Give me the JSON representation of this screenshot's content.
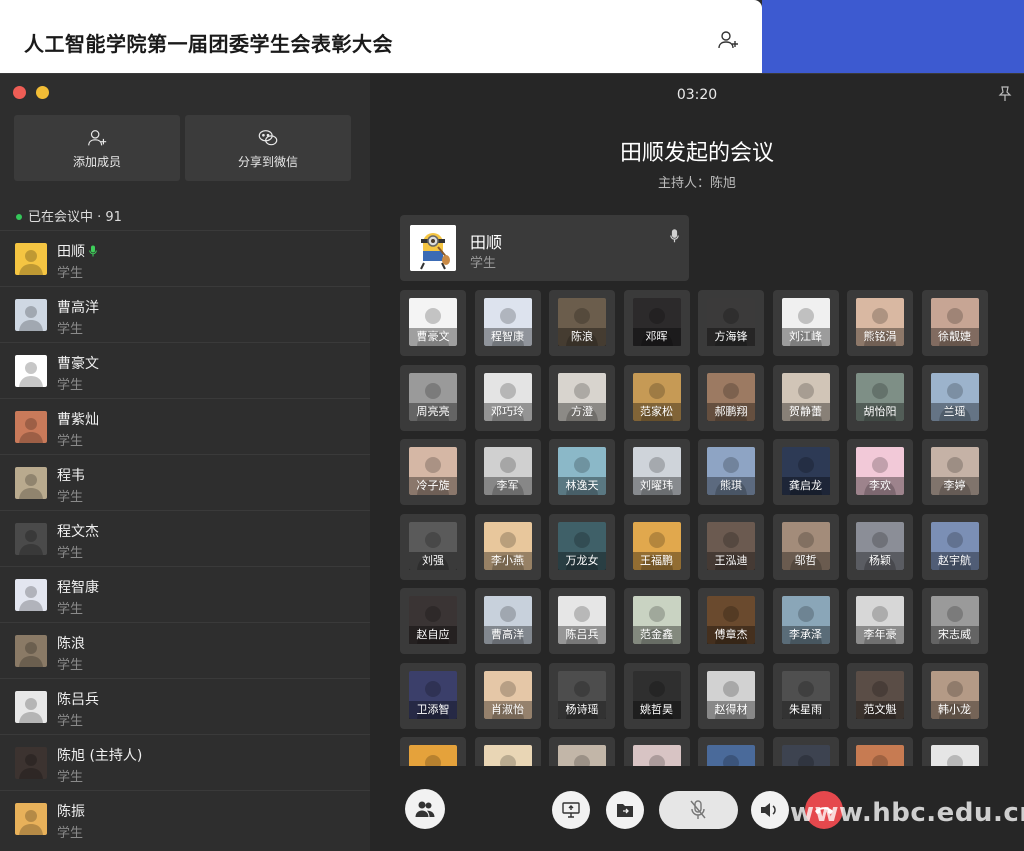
{
  "background": {
    "page_title": "人工智能学院第一届团委学生会表彰大会"
  },
  "sidebar": {
    "add_member_label": "添加成员",
    "share_wechat_label": "分享到微信",
    "in_meeting_label": "已在会议中 · 91",
    "members": [
      {
        "name": "田顺",
        "role": "学生",
        "speaking": true,
        "avatar": "minion",
        "color": "#f5c542"
      },
      {
        "name": "曹高洋",
        "role": "学生",
        "avatar": "anime",
        "color": "#cfd8e3"
      },
      {
        "name": "曹豪文",
        "role": "学生",
        "avatar": "sketch",
        "color": "#ffffff"
      },
      {
        "name": "曹紫灿",
        "role": "学生",
        "avatar": "portrait",
        "color": "#c97a5a"
      },
      {
        "name": "程韦",
        "role": "学生",
        "avatar": "photo",
        "color": "#b9aa8e"
      },
      {
        "name": "程文杰",
        "role": "学生",
        "avatar": "photo",
        "color": "#4a4a4a"
      },
      {
        "name": "程智康",
        "role": "学生",
        "avatar": "anime",
        "color": "#e3e6f0"
      },
      {
        "name": "陈浪",
        "role": "学生",
        "avatar": "photo",
        "color": "#8a7a66"
      },
      {
        "name": "陈吕兵",
        "role": "学生",
        "avatar": "sketch",
        "color": "#e8e8e8"
      },
      {
        "name": "陈旭 (主持人)",
        "role": "学生",
        "avatar": "portrait",
        "color": "#3c3330"
      },
      {
        "name": "陈振",
        "role": "学生",
        "avatar": "cartoon",
        "color": "#e8b15a"
      }
    ]
  },
  "main": {
    "timer": "03:20",
    "meeting_title": "田顺发起的会议",
    "host_label": "主持人：陈旭",
    "speaker": {
      "name": "田顺",
      "role": "学生"
    },
    "participants": [
      {
        "name": "曹豪文",
        "color": "#f4f4f4"
      },
      {
        "name": "程智康",
        "color": "#dde3ee"
      },
      {
        "name": "陈浪",
        "color": "#6b5d4c"
      },
      {
        "name": "邓晖",
        "color": "#2c2a2b"
      },
      {
        "name": "方海锋",
        "color": "#3b3a3a"
      },
      {
        "name": "刘江峰",
        "color": "#f0f0f0"
      },
      {
        "name": "熊铭涓",
        "color": "#d9b8a2"
      },
      {
        "name": "徐靓婕",
        "color": "#c7a594"
      },
      {
        "name": "周亮亮",
        "color": "#9a9a9a"
      },
      {
        "name": "邓巧玲",
        "color": "#e4e4e4"
      },
      {
        "name": "方澄",
        "color": "#d8d4ce"
      },
      {
        "name": "范家松",
        "color": "#c69a55"
      },
      {
        "name": "郝鹏翔",
        "color": "#9c7a62"
      },
      {
        "name": "贺静蕾",
        "color": "#d1c5b7"
      },
      {
        "name": "胡怡阳",
        "color": "#7e8f86"
      },
      {
        "name": "兰瑶",
        "color": "#9cb3cc"
      },
      {
        "name": "冷子旋",
        "color": "#d5b7a5"
      },
      {
        "name": "李军",
        "color": "#d0d0d0"
      },
      {
        "name": "林逸天",
        "color": "#8bb8c8"
      },
      {
        "name": "刘曜玮",
        "color": "#cfd4da"
      },
      {
        "name": "熊琪",
        "color": "#8ea4c4"
      },
      {
        "name": "龚启龙",
        "color": "#2d3a55"
      },
      {
        "name": "李欢",
        "color": "#f2c9d8"
      },
      {
        "name": "李婷",
        "color": "#c5b2a6"
      },
      {
        "name": "刘强",
        "color": "#5a5a5a"
      },
      {
        "name": "李小燕",
        "color": "#e8c79c"
      },
      {
        "name": "万龙女",
        "color": "#3f6068"
      },
      {
        "name": "王福鹏",
        "color": "#e1a84d"
      },
      {
        "name": "王泓迪",
        "color": "#6b5a50"
      },
      {
        "name": "邬哲",
        "color": "#a38c7a"
      },
      {
        "name": "杨颖",
        "color": "#8b8e97"
      },
      {
        "name": "赵宇航",
        "color": "#7b8fb5"
      },
      {
        "name": "赵自应",
        "color": "#3a3434"
      },
      {
        "name": "曹高洋",
        "color": "#c8d1dc"
      },
      {
        "name": "陈吕兵",
        "color": "#e6e6e6"
      },
      {
        "name": "范金鑫",
        "color": "#c9d3c2"
      },
      {
        "name": "傅章杰",
        "color": "#6a4a2e"
      },
      {
        "name": "李承泽",
        "color": "#8aa6b8"
      },
      {
        "name": "李年豪",
        "color": "#d7d7d7"
      },
      {
        "name": "宋志威",
        "color": "#9a9a9a"
      },
      {
        "name": "卫添智",
        "color": "#3b3f6a"
      },
      {
        "name": "肖淑怡",
        "color": "#e5c7a7"
      },
      {
        "name": "杨诗瑶",
        "color": "#4d4d4d"
      },
      {
        "name": "姚哲昊",
        "color": "#2f2f2f"
      },
      {
        "name": "赵得材",
        "color": "#d2d2d2"
      },
      {
        "name": "朱星雨",
        "color": "#4f4f4f"
      },
      {
        "name": "范文魁",
        "color": "#5a4d46"
      },
      {
        "name": "韩小龙",
        "color": "#b49a86"
      },
      {
        "name": "",
        "color": "#e5a23b"
      },
      {
        "name": "",
        "color": "#e9d6b5"
      },
      {
        "name": "",
        "color": "#c2b6a8"
      },
      {
        "name": "",
        "color": "#d8c4c4"
      },
      {
        "name": "",
        "color": "#4a6a9a"
      },
      {
        "name": "",
        "color": "#3d4350"
      },
      {
        "name": "",
        "color": "#c77b52"
      },
      {
        "name": "",
        "color": "#e6e6e6"
      }
    ]
  },
  "toolbar": {
    "buttons": [
      "members-icon",
      "screen-share-icon",
      "file-share-icon",
      "mic-off-icon",
      "speaker-icon",
      "end-call-icon"
    ]
  },
  "watermark": "www.hbc.edu.cn"
}
